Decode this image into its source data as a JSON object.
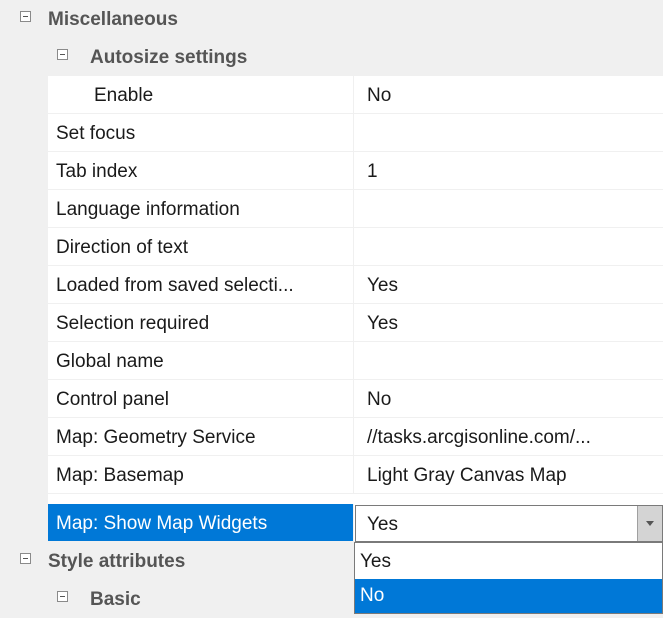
{
  "categories": {
    "miscellaneous": "Miscellaneous",
    "autosize": "Autosize settings",
    "style_attributes": "Style attributes",
    "basic": "Basic"
  },
  "properties": [
    {
      "name": "Enable",
      "value": "No"
    },
    {
      "name": "Set focus",
      "value": ""
    },
    {
      "name": "Tab index",
      "value": "1"
    },
    {
      "name": "Language information",
      "value": ""
    },
    {
      "name": "Direction of text",
      "value": ""
    },
    {
      "name": "Loaded from saved selecti...",
      "value": "Yes"
    },
    {
      "name": "Selection required",
      "value": "Yes"
    },
    {
      "name": "Global name",
      "value": ""
    },
    {
      "name": "Control panel",
      "value": "No"
    },
    {
      "name": "Map: Geometry Service",
      "value": "//tasks.arcgisonline.com/..."
    },
    {
      "name": "Map: Basemap",
      "value": "Light Gray Canvas Map"
    },
    {
      "name": "Map: Show Map Widgets",
      "value": "Yes"
    }
  ],
  "selected_property": "Map: Show Map Widgets",
  "dropdown": {
    "options": [
      "Yes",
      "No"
    ],
    "highlighted": "No"
  },
  "colors": {
    "selection": "#0078d7",
    "category_background": "#f0f0f0",
    "gridline": "#f0f0f0"
  },
  "icons": {
    "category_toggle": "collapse-minus-icon",
    "editor_button": "dropdown-arrow-icon"
  }
}
